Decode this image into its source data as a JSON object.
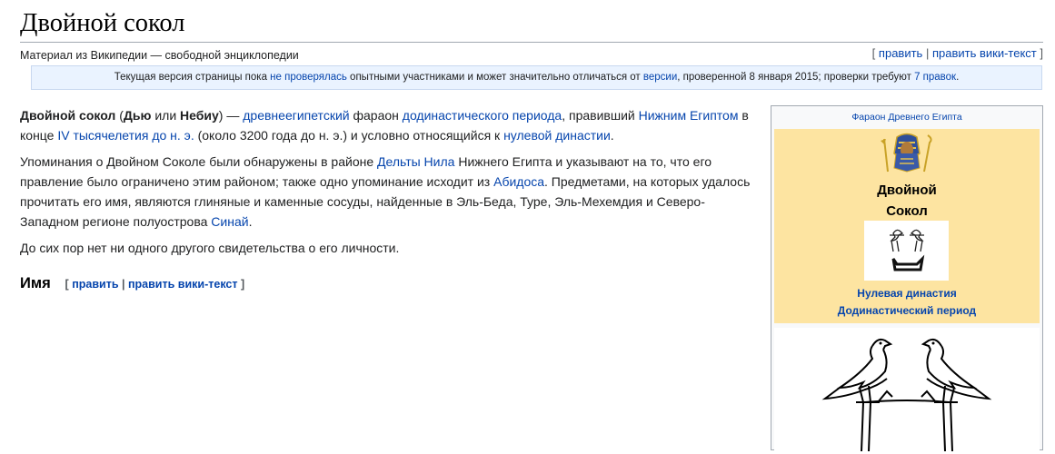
{
  "page": {
    "title": "Двойной сокол",
    "tagline": "Материал из Википедии — свободной энциклопедии"
  },
  "edit_links": {
    "open": "[",
    "edit": "править",
    "sep": "|",
    "edit_source": "править вики-текст",
    "close": "]"
  },
  "notice": {
    "text1": "Текущая версия страницы пока ",
    "link1": "не проверялась",
    "text2": " опытными участниками и может значительно отличаться от ",
    "link2": "версии",
    "text3": ", проверенной 8 января 2015; проверки требуют ",
    "link3": "7 правок",
    "text4": "."
  },
  "paragraphs": {
    "p1": {
      "b1": "Двойной сокол",
      "t1": " (",
      "b2": "Дью",
      "t2": " или ",
      "b3": "Небиу",
      "t3": ") — ",
      "l1": "древнеегипетский",
      "t4": " фараон ",
      "l2": "додинастического периода",
      "t5": ", правивший ",
      "l3": "Нижним Египтом",
      "t6": " в конце ",
      "l4": "IV тысячелетия до н. э.",
      "t7": " (около 3200 года до н. э.) и условно относящийся к ",
      "l5": "нулевой династии",
      "t8": "."
    },
    "p2": {
      "t1": "Упоминания о Двойном Соколе были обнаружены в районе ",
      "l1": "Дельты Нила",
      "t2": " Нижнего Египта и указывают на то, что его правление было ограничено этим районом; также одно упоминание исходит из ",
      "l2": "Абидоса",
      "t3": ". Предметами, на которых удалось прочитать его имя, являются глиняные и каменные сосуды, найденные в Эль-Беда, Туре, Эль-Мехемдия и Северо-Западном регионе полуострова ",
      "l3": "Синай",
      "t4": "."
    },
    "p3": "До сих пор нет ни одного другого свидетельства о его личности."
  },
  "section": {
    "title": "Имя"
  },
  "infobox": {
    "caption": "Фараон Древнего Египта",
    "name_line1": "Двойной",
    "name_line2": "Сокол",
    "dynasty": "Нулевая династия",
    "period": "Додинастический период"
  },
  "colors": {
    "link": "#0645ad",
    "infobox_header": "#fde4a1",
    "notice_bg": "#eaf3ff"
  }
}
